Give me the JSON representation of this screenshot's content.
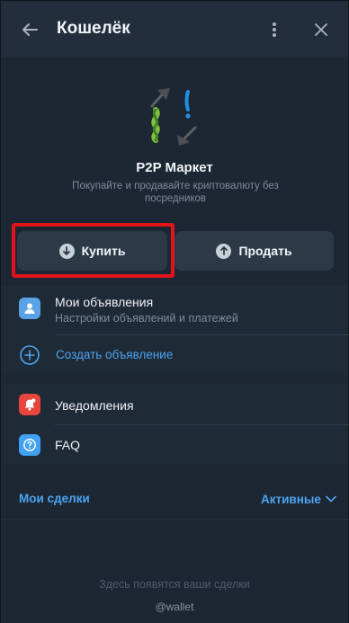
{
  "header": {
    "title": "Кошелёк"
  },
  "hero": {
    "title": "P2P Маркет",
    "subtitle": "Покупайте и продавайте криптовалюту без посредников"
  },
  "actions": {
    "buy_label": "Купить",
    "sell_label": "Продать"
  },
  "ads": {
    "my_ads_label": "Мои объявления",
    "my_ads_sub": "Настройки объявлений и платежей",
    "create_ad_label": "Создать объявление"
  },
  "misc": {
    "notifications_label": "Уведомления",
    "faq_label": "FAQ"
  },
  "deals": {
    "title": "Мои сделки",
    "filter_label": "Активные",
    "empty_text": "Здесь появятся ваши сделки"
  },
  "footer": {
    "handle": "@wallet"
  },
  "colors": {
    "accent": "#4ea3f1",
    "highlight": "#e3131b",
    "notification_icon_bg": "#e8453c",
    "faq_icon_bg": "#41a0f0",
    "my_ads_icon_bg": "#5aa2e6"
  }
}
